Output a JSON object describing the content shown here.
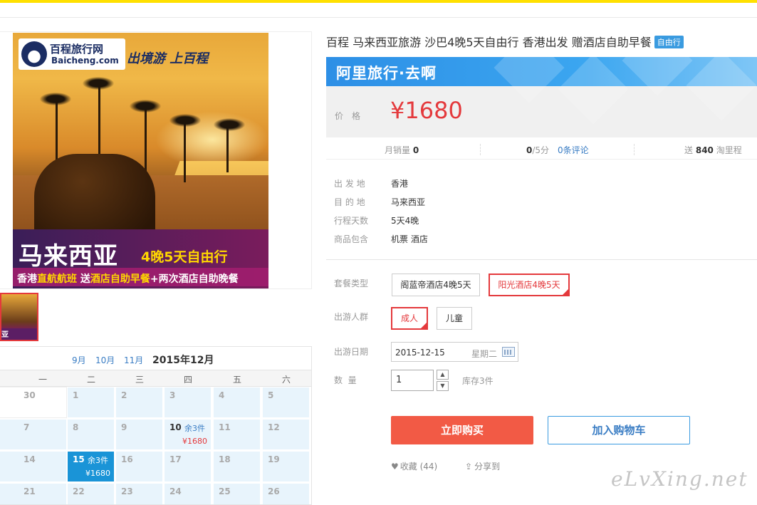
{
  "gallery": {
    "logo_cn": "百程旅行网",
    "logo_en": "Baicheng.com",
    "slogan": "出境游 上百程",
    "banner_title": "马来西亚",
    "banner_sub": "4晚5天自由行",
    "banner_line_a": "香港",
    "banner_line_b": "直航航班",
    "banner_line_c": " 送",
    "banner_line_d": "酒店自助早餐",
    "banner_line_e": "+两次酒店自助晚餐",
    "thumb_text": "亚"
  },
  "calendar": {
    "months": [
      "9月",
      "10月",
      "11月"
    ],
    "current": "2015年12月",
    "weekdays": [
      "一",
      "二",
      "三",
      "四",
      "五",
      "六"
    ],
    "rows": [
      [
        {
          "d": "30",
          "type": "blank"
        },
        {
          "d": "1"
        },
        {
          "d": "2"
        },
        {
          "d": "3"
        },
        {
          "d": "4"
        },
        {
          "d": "5"
        }
      ],
      [
        {
          "d": "7"
        },
        {
          "d": "8"
        },
        {
          "d": "9"
        },
        {
          "d": "10",
          "stock": "余3件",
          "price": "¥1680",
          "type": "avail"
        },
        {
          "d": "11"
        },
        {
          "d": "12"
        }
      ],
      [
        {
          "d": "14"
        },
        {
          "d": "15",
          "stock": "余3件",
          "price": "¥1680",
          "type": "sel"
        },
        {
          "d": "16"
        },
        {
          "d": "17"
        },
        {
          "d": "18"
        },
        {
          "d": "19"
        }
      ],
      [
        {
          "d": "21"
        },
        {
          "d": "22"
        },
        {
          "d": "23"
        },
        {
          "d": "24"
        },
        {
          "d": "25"
        },
        {
          "d": "26"
        }
      ]
    ]
  },
  "product": {
    "title": "百程 马来西亚旅游 沙巴4晚5天自由行 香港出发 赠酒店自助早餐",
    "tag": "自由行",
    "alitrip": "阿里旅行·去啊",
    "price_label": "价格",
    "price": "¥1680"
  },
  "stats": {
    "sales_label": "月销量",
    "sales": "0",
    "rating": "0",
    "rating_suffix": "/5分",
    "reviews": "0条评论",
    "points_prefix": "送",
    "points": "840",
    "points_suffix": "淘里程"
  },
  "attrs": [
    {
      "k": "出 发 地",
      "v": "香港"
    },
    {
      "k": "目 的 地",
      "v": "马来西亚"
    },
    {
      "k": "行程天数",
      "v": "5天4晚"
    },
    {
      "k": "商品包含",
      "v": "机票 酒店"
    }
  ],
  "options": {
    "package_label": "套餐类型",
    "packages": [
      "阁蓝帝酒店4晚5天",
      "阳光酒店4晚5天"
    ],
    "people_label": "出游人群",
    "people": [
      "成人",
      "儿童"
    ],
    "date_label": "出游日期",
    "date": "2015-12-15",
    "weekday": "星期二",
    "qty_label": "数  量",
    "qty": "1",
    "stock": "库存3件"
  },
  "actions": {
    "buy": "立即购买",
    "cart": "加入购物车",
    "fav": "收藏",
    "fav_count": "(44)",
    "share": "分享到"
  },
  "watermark": "eLvXing.net",
  "colors": {
    "accent": "#e4393c",
    "brand_blue": "#3a9be0",
    "top_bar": "#ffe000",
    "calendar_selected": "#1a94d7"
  }
}
